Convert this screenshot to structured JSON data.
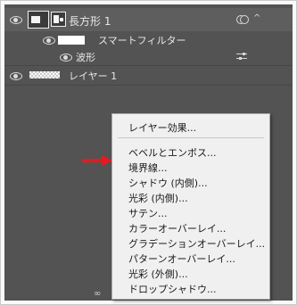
{
  "layers_panel": {
    "layer_shape": {
      "name": "長方形 1",
      "expand_icon": "chevron-up-icon",
      "link_icon": "linked-overlap-icon"
    },
    "smart_filters": {
      "label": "スマートフィルター"
    },
    "filter_wave": {
      "label": "波形",
      "options_icon": "sliders-icon"
    },
    "layer_base": {
      "name": "レイヤー 1"
    }
  },
  "context_menu": {
    "top_item": "レイヤー効果...",
    "items": [
      "ベベルとエンボス...",
      "境界線...",
      "シャドウ (内側)...",
      "光彩 (内側)...",
      "サテン...",
      "カラーオーバーレイ...",
      "グラデーションオーバーレイ...",
      "パターンオーバーレイ...",
      "光彩 (外側)...",
      "ドロップシャドウ..."
    ],
    "highlighted_index": 1
  },
  "annotation": {
    "arrow_color": "#e21b23"
  },
  "colors": {
    "panel_bg": "#535353",
    "selected_row": "#5e5e5e",
    "menu_bg": "#f0f0f0"
  }
}
